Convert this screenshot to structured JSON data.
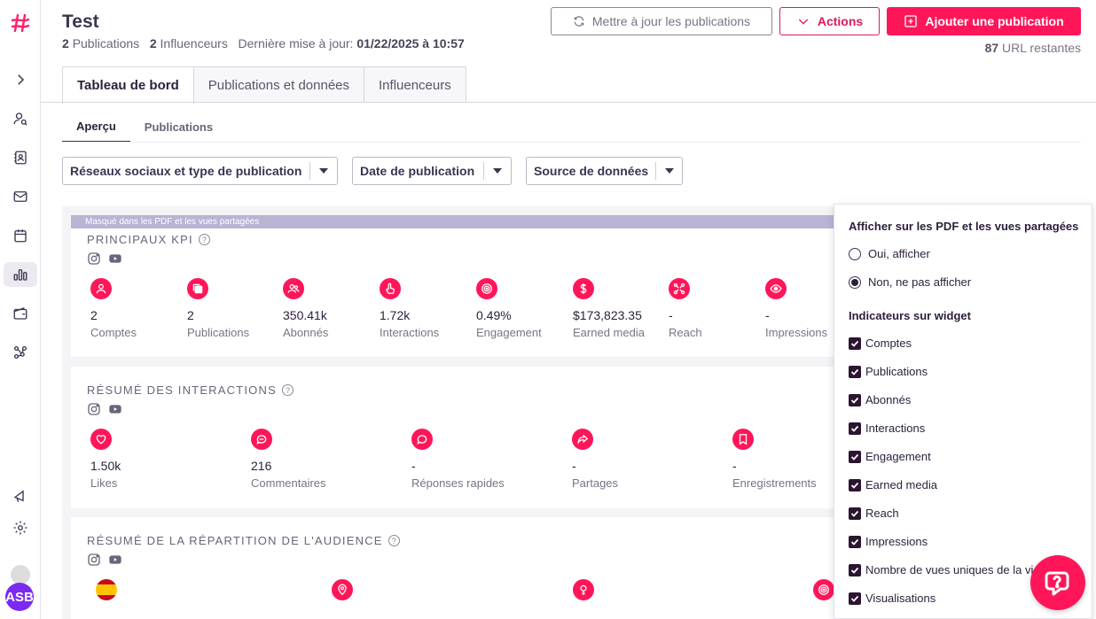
{
  "sidebar": {
    "logo_icon": "hashtag-logo-icon",
    "items": [
      "chevron-right-icon",
      "user-search-icon",
      "contacts-book-icon",
      "mail-icon",
      "calendar-icon",
      "bar-chart-icon",
      "wallet-icon",
      "network-icon",
      "megaphone-icon",
      "gear-icon"
    ],
    "active_item": "bar-chart-icon",
    "avatar_initials": "ASB",
    "avatar_color": "#7b2bf0"
  },
  "header": {
    "title": "Test",
    "publications_count": "2",
    "publications_label": "Publications",
    "influencers_count": "2",
    "influencers_label": "Influenceurs",
    "last_update_label": "Dernière mise à jour:",
    "last_update_value": "01/22/2025 à 10:57",
    "update_button": "Mettre à jour les publications",
    "actions_button": "Actions",
    "add_button": "Ajouter une publication",
    "urls_count": "87",
    "urls_label": "URL restantes"
  },
  "tabs": [
    "Tableau de bord",
    "Publications et données",
    "Influenceurs"
  ],
  "active_tab": "Tableau de bord",
  "subtabs": [
    "Aperçu",
    "Publications"
  ],
  "active_subtab": "Aperçu",
  "filters": [
    "Réseaux sociaux et type de publication",
    "Date de publication",
    "Source de données"
  ],
  "hidden_banner": "Masqué dans les PDF et les vues partagées",
  "kpi": {
    "title": "PRINCIPAUX KPI",
    "metrics": [
      {
        "icon": "user-icon",
        "value": "2",
        "label": "Comptes"
      },
      {
        "icon": "copy-icon",
        "value": "2",
        "label": "Publications"
      },
      {
        "icon": "users-icon",
        "value": "350.41k",
        "label": "Abonnés"
      },
      {
        "icon": "hand-pointer-icon",
        "value": "1.72k",
        "label": "Interactions"
      },
      {
        "icon": "target-icon",
        "value": "0.49%",
        "label": "Engagement"
      },
      {
        "icon": "dollar-icon",
        "value": "$173,823.35",
        "label": "Earned media"
      },
      {
        "icon": "share-nodes-icon",
        "value": "-",
        "label": "Reach"
      },
      {
        "icon": "eye-icon",
        "value": "-",
        "label": "Impressions"
      }
    ]
  },
  "interactions": {
    "title": "RÉSUMÉ DES INTERACTIONS",
    "metrics": [
      {
        "icon": "heart-icon",
        "value": "1.50k",
        "label": "Likes"
      },
      {
        "icon": "comment-icon",
        "value": "216",
        "label": "Commentaires"
      },
      {
        "icon": "quick-reply-icon",
        "value": "-",
        "label": "Réponses rapides"
      },
      {
        "icon": "share-icon",
        "value": "-",
        "label": "Partages"
      },
      {
        "icon": "bookmark-icon",
        "value": "-",
        "label": "Enregistrements"
      }
    ]
  },
  "audience": {
    "title": "RÉSUMÉ DE LA RÉPARTITION DE L'AUDIENCE",
    "icons": [
      "spain-flag-icon",
      "location-pin-icon",
      "female-icon",
      "target-icon"
    ]
  },
  "panel": {
    "show_title": "Afficher sur les PDF et les vues partagées",
    "options": [
      {
        "label": "Oui, afficher",
        "selected": false
      },
      {
        "label": "Non, ne pas afficher",
        "selected": true
      }
    ],
    "indicators_title": "Indicateurs sur widget",
    "indicators": [
      "Comptes",
      "Publications",
      "Abonnés",
      "Interactions",
      "Engagement",
      "Earned media",
      "Reach",
      "Impressions",
      "Nombre de vues uniques de la vi",
      "Visualisations"
    ]
  },
  "colors": {
    "accent": "#ff1659",
    "dark": "#2b1f3a",
    "banner": "#b9b3d4"
  },
  "help_widget_icon": "help-chat-icon"
}
